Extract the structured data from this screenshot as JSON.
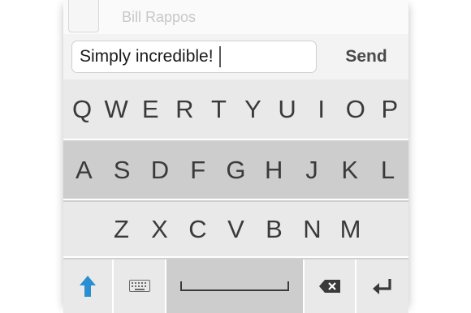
{
  "contact": {
    "name": "Bill Rappos"
  },
  "compose": {
    "message_value": "Simply incredible!",
    "send_label": "Send"
  },
  "keyboard": {
    "row1": [
      "Q",
      "W",
      "E",
      "R",
      "T",
      "Y",
      "U",
      "I",
      "O",
      "P"
    ],
    "row2": [
      "A",
      "S",
      "D",
      "F",
      "G",
      "H",
      "J",
      "K",
      "L"
    ],
    "row3": [
      "Z",
      "X",
      "C",
      "V",
      "B",
      "N",
      "M"
    ],
    "icons": {
      "shift": "shift-arrow-icon",
      "switch": "keyboard-icon",
      "space": "space-bar-icon",
      "backspace": "backspace-icon",
      "return": "return-arrow-icon"
    }
  },
  "colors": {
    "shift_accent": "#2a8fd0",
    "key_text": "#3a3a3a",
    "light_row": "#e9e9e9",
    "dark_row": "#cdcdcd"
  }
}
